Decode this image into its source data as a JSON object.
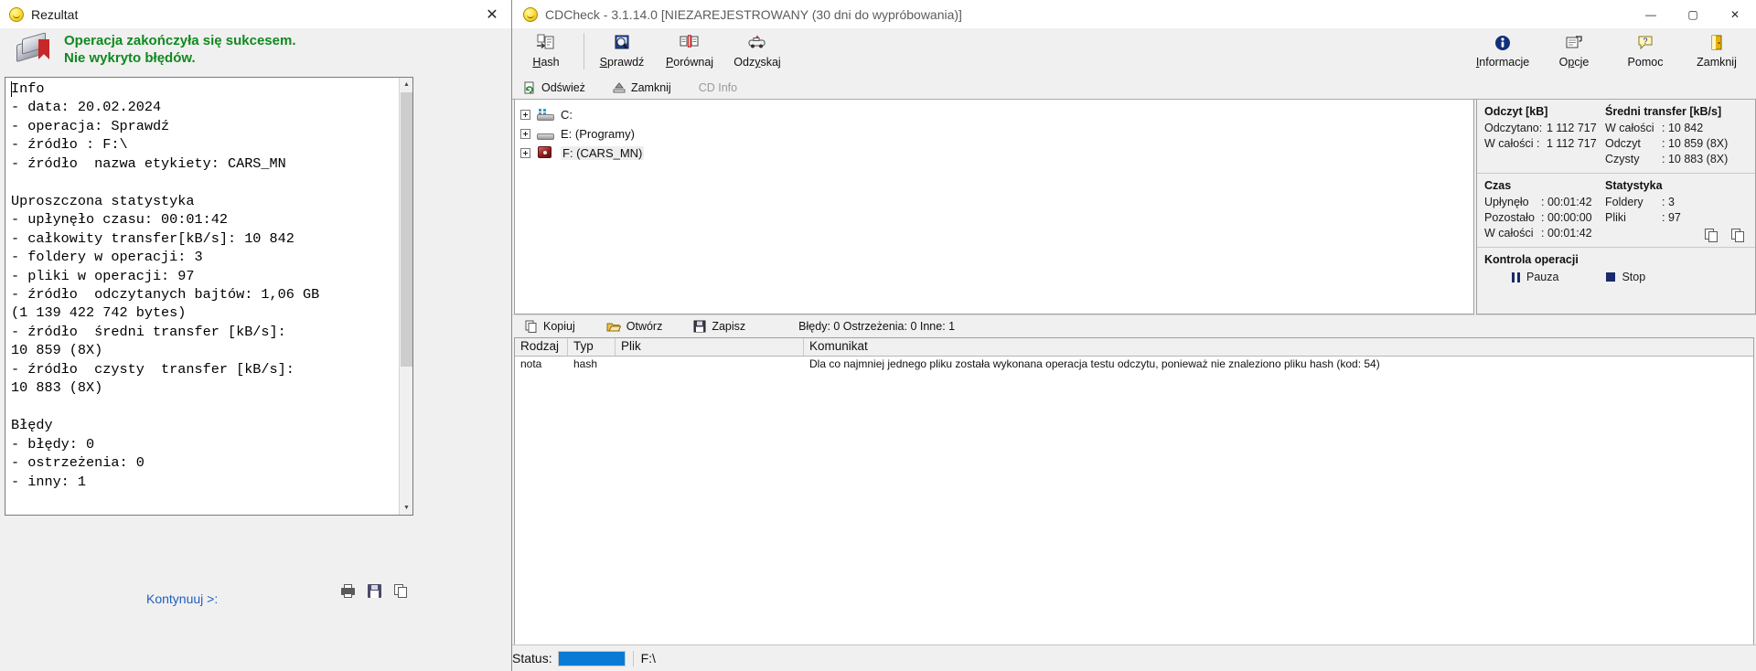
{
  "result_dialog": {
    "title": "Rezultat",
    "title_icon": "cd-disc-icon",
    "close_label": "✕",
    "banner": {
      "line1": "Operacja zakończyła się sukcesem.",
      "line2": "Nie wykryto błędów.",
      "color": "#0f8a1e"
    },
    "report_text": "Info\n- data: 20.02.2024\n- operacja: Sprawdź\n- źródło : F:\\\n- źródło  nazwa etykiety: CARS_MN\n\nUproszczona statystyka\n- upłynęło czasu: 00:01:42\n- całkowity transfer[kB/s]: 10 842\n- foldery w operacji: 3\n- pliki w operacji: 97\n- źródło  odczytanych bajtów: 1,06 GB\n(1 139 422 742 bytes)\n- źródło  średni transfer [kB/s]:\n10 859 (8X)\n- źródło  czysty  transfer [kB/s]:\n10 883 (8X)\n\nBłędy\n- błędy: 0\n- ostrzeżenia: 0\n- inny: 1",
    "continue_label": "Kontynuuj >:",
    "footer_icons": [
      "printer-icon",
      "save-icon",
      "copy-icon"
    ]
  },
  "cdcheck": {
    "title": "CDCheck - 3.1.14.0 [NIEZAREJESTROWANY (30 dni do wypróbowania)]",
    "window_buttons": {
      "minimize": "—",
      "maximize": "▢",
      "close": "✕"
    },
    "toolbar": {
      "left_items": [
        {
          "label": "Hash",
          "accel": "H",
          "icon": "hash-icon"
        },
        {
          "label": "Sprawdź",
          "accel": "S",
          "icon": "verify-magnifier-icon"
        },
        {
          "label": "Porównaj",
          "accel": "P",
          "icon": "compare-icon"
        },
        {
          "label": "Odzyskaj",
          "accel": "y",
          "icon": "recover-icon"
        }
      ],
      "right_items": [
        {
          "label": "Informacje",
          "accel": "I",
          "icon": "info-icon"
        },
        {
          "label": "Opcje",
          "accel": "p",
          "icon": "options-icon"
        },
        {
          "label": "Pomoc",
          "accel": "",
          "icon": "help-icon"
        },
        {
          "label": "Zamknij",
          "accel": "",
          "icon": "exit-door-icon"
        }
      ]
    },
    "subbar": [
      {
        "label": "Odśwież",
        "icon": "refresh-icon",
        "disabled": false
      },
      {
        "label": "Zamknij",
        "icon": "eject-icon",
        "disabled": false
      },
      {
        "label": "CD Info",
        "icon": "",
        "disabled": true
      }
    ],
    "tree": [
      {
        "label": "C:",
        "icon": "system-drive-icon",
        "expander": "+"
      },
      {
        "label": "E: (Programy)",
        "icon": "hard-drive-icon",
        "expander": "+"
      },
      {
        "label": "F: (CARS_MN)",
        "icon": "cd-drive-icon",
        "expander": "+",
        "selected": true
      }
    ],
    "stats": {
      "read": {
        "header": "Odczyt [kB]",
        "rows": [
          {
            "key": "Odczytano:",
            "value": "1 112 717"
          },
          {
            "key": "W całości  :",
            "value": "1 112 717"
          }
        ]
      },
      "avg_transfer": {
        "header": "Średni transfer [kB/s]",
        "rows": [
          {
            "key": "W całości",
            "value": ": 10 842"
          },
          {
            "key": "Odczyt",
            "value": ": 10 859 (8X)"
          },
          {
            "key": "Czysty",
            "value": ": 10 883 (8X)"
          }
        ]
      },
      "time": {
        "header": "Czas",
        "rows": [
          {
            "key": "Upłynęło",
            "value": ": 00:01:42"
          },
          {
            "key": "Pozostało",
            "value": ": 00:00:00"
          },
          {
            "key": "W całości",
            "value": ": 00:01:42"
          }
        ]
      },
      "statistics": {
        "header": "Statystyka",
        "rows": [
          {
            "key": "Foldery",
            "value": ": 3"
          },
          {
            "key": "Pliki",
            "value": ": 97"
          }
        ]
      },
      "copy_icons": [
        "copy-report-icon",
        "copy-clipboard-icon"
      ]
    },
    "operation_control": {
      "header": "Kontrola operacji",
      "pause_label": "Pauza",
      "stop_label": "Stop",
      "glyph_color": "#1b2a6b"
    },
    "results_toolbar": {
      "buttons": [
        {
          "label": "Kopiuj",
          "icon": "copy-icon"
        },
        {
          "label": "Otwórz",
          "icon": "open-folder-icon"
        },
        {
          "label": "Zapisz",
          "icon": "save-disk-icon"
        }
      ],
      "counts": "Błędy: 0 Ostrzeżenia: 0 Inne: 1"
    },
    "results_table": {
      "columns": [
        "Rodzaj",
        "Typ",
        "Plik",
        "Komunikat"
      ],
      "rows": [
        {
          "rodzaj": "nota",
          "typ": "hash",
          "plik": "",
          "komunikat": "Dla co najmniej jednego pliku została wykonana operacja testu odczytu, ponieważ nie znaleziono pliku hash (kod: 54)"
        }
      ]
    },
    "statusbar": {
      "label": "Status:",
      "progress_color": "#0a7bd4",
      "path": "F:\\"
    }
  }
}
